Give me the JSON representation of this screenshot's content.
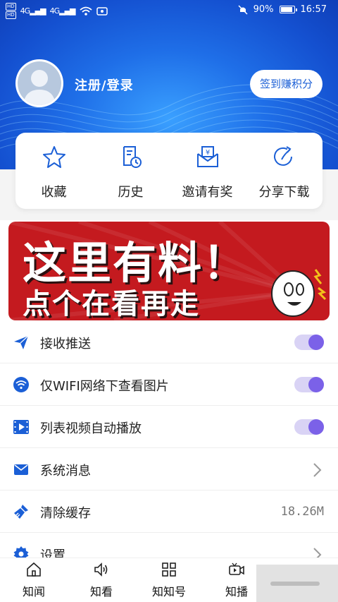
{
  "status_bar": {
    "hd1": "HD",
    "hd2": "HD",
    "signal1": "4G",
    "signal2": "4G",
    "battery": "90%",
    "time": "16:57"
  },
  "profile": {
    "login_text": "注册/登录",
    "signin_button": "签到赚积分"
  },
  "quick_actions": [
    {
      "label": "收藏",
      "icon": "star-icon"
    },
    {
      "label": "历史",
      "icon": "history-icon"
    },
    {
      "label": "邀请有奖",
      "icon": "invite-icon"
    },
    {
      "label": "分享下载",
      "icon": "share-icon"
    }
  ],
  "banner": {
    "line1": "这里有料！",
    "line2": "点个在看再走"
  },
  "settings": [
    {
      "label": "接收推送",
      "icon": "send-icon",
      "type": "toggle",
      "on": true
    },
    {
      "label": "仅WIFI网络下查看图片",
      "icon": "wifi-icon",
      "type": "toggle",
      "on": true
    },
    {
      "label": "列表视频自动播放",
      "icon": "video-icon",
      "type": "toggle",
      "on": true
    },
    {
      "label": "系统消息",
      "icon": "mail-icon",
      "type": "chevron"
    },
    {
      "label": "清除缓存",
      "icon": "broom-icon",
      "type": "value",
      "value": "18.26M"
    },
    {
      "label": "设置",
      "icon": "gear-icon",
      "type": "chevron"
    }
  ],
  "tabbar": [
    {
      "label": "知闻",
      "icon": "home-icon"
    },
    {
      "label": "知看",
      "icon": "speaker-icon"
    },
    {
      "label": "知知号",
      "icon": "grid-icon"
    },
    {
      "label": "知播",
      "icon": "video-camera-icon"
    }
  ],
  "colors": {
    "accent": "#1b5fd6",
    "toggle_on": "#7b61e8",
    "banner_red": "#c41a1f"
  }
}
